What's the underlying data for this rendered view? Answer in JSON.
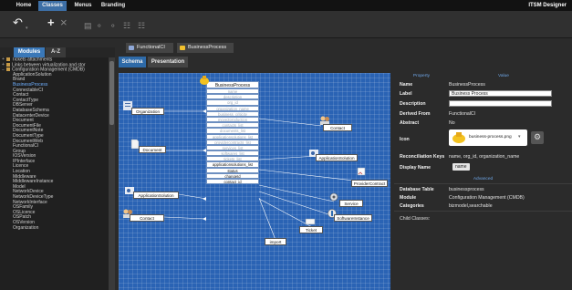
{
  "menu": {
    "tabs": [
      {
        "label": "Home",
        "active": false
      },
      {
        "label": "Classes",
        "active": true
      },
      {
        "label": "Menus",
        "active": false
      },
      {
        "label": "Branding",
        "active": false
      }
    ],
    "app_title": "ITSM Designer"
  },
  "toolbar": {
    "undo_icon": "undo-icon",
    "add_icon": "plus-icon",
    "delete_icon": "close-icon"
  },
  "left_panel": {
    "tabs": [
      {
        "label": "Modules",
        "active": true
      },
      {
        "label": "A-Z",
        "active": false
      }
    ],
    "tree": [
      {
        "label": "Tickets attachments",
        "folder": true,
        "expander": "+",
        "indent": 0
      },
      {
        "label": "Links between virtualization and stor",
        "folder": true,
        "expander": "+",
        "indent": 0
      },
      {
        "label": "Configuration Management (CMDB)",
        "folder": true,
        "expander": "−",
        "indent": 0
      },
      {
        "label": "ApplicationSolution",
        "indent": 1
      },
      {
        "label": "Brand",
        "indent": 1
      },
      {
        "label": "BusinessProcess",
        "indent": 1,
        "selected": true
      },
      {
        "label": "ConnectableCI",
        "indent": 1
      },
      {
        "label": "Contact",
        "indent": 1
      },
      {
        "label": "ContactType",
        "indent": 1
      },
      {
        "label": "DBServer",
        "indent": 1
      },
      {
        "label": "DatabaseSchema",
        "indent": 1
      },
      {
        "label": "DatacenterDevice",
        "indent": 1
      },
      {
        "label": "Document",
        "indent": 1
      },
      {
        "label": "DocumentFile",
        "indent": 1
      },
      {
        "label": "DocumentNote",
        "indent": 1
      },
      {
        "label": "DocumentType",
        "indent": 1
      },
      {
        "label": "DocumentWeb",
        "indent": 1
      },
      {
        "label": "FunctionalCI",
        "indent": 1
      },
      {
        "label": "Group",
        "indent": 1
      },
      {
        "label": "IOSVersion",
        "indent": 1
      },
      {
        "label": "IPInterface",
        "indent": 1
      },
      {
        "label": "Licence",
        "indent": 1
      },
      {
        "label": "Location",
        "indent": 1
      },
      {
        "label": "Middleware",
        "indent": 1
      },
      {
        "label": "MiddlewareInstance",
        "indent": 1
      },
      {
        "label": "Model",
        "indent": 1
      },
      {
        "label": "NetworkDevice",
        "indent": 1
      },
      {
        "label": "NetworkDeviceType",
        "indent": 1
      },
      {
        "label": "NetworkInterface",
        "indent": 1
      },
      {
        "label": "OSFamily",
        "indent": 1
      },
      {
        "label": "OSLicence",
        "indent": 1
      },
      {
        "label": "OSPatch",
        "indent": 1
      },
      {
        "label": "OSVersion",
        "indent": 1
      },
      {
        "label": "Organization",
        "indent": 1
      }
    ]
  },
  "doc_tabs": [
    {
      "label": "FunctionalCI",
      "icon": "class-icon",
      "color": "#8fa8d8"
    },
    {
      "label": "BusinessProcess",
      "icon": "business-process-icon",
      "color": "#f2c12e"
    }
  ],
  "view_tabs": [
    {
      "label": "Schema",
      "active": true
    },
    {
      "label": "Presentation",
      "active": false
    }
  ],
  "schema": {
    "main_class": "BusinessProcess",
    "attributes": [
      {
        "label": "name",
        "strong": false
      },
      {
        "label": "description",
        "strong": false
      },
      {
        "label": "org_id",
        "strong": false
      },
      {
        "label": "organization_name",
        "strong": false
      },
      {
        "label": "business_criticity",
        "strong": false
      },
      {
        "label": "move2production",
        "strong": false
      },
      {
        "label": "contacts_list",
        "strong": false
      },
      {
        "label": "documents_list",
        "strong": false
      },
      {
        "label": "applicationsolutions_list",
        "strong": false
      },
      {
        "label": "providercontracts_list",
        "strong": false
      },
      {
        "label": "services_list",
        "strong": false
      },
      {
        "label": "softwares_list",
        "strong": false
      },
      {
        "label": "tickets_list",
        "strong": false
      },
      {
        "label": "applicationsolutions_list",
        "strong": true
      },
      {
        "label": "status",
        "strong": true
      },
      {
        "label": "changeId",
        "strong": true
      },
      {
        "label": "contact_id",
        "strong": true
      }
    ],
    "related": {
      "organization": "Organization",
      "document": "Document",
      "contact": "Contact",
      "application_solution": "ApplicationSolution",
      "provider_contract": "ProviderContract",
      "service": "Service",
      "software_instance": "SoftwareInstance",
      "ticket": "Ticket",
      "application_solution_left": "ApplicationSolution",
      "contact_left": "Contact",
      "import": "import"
    }
  },
  "properties": {
    "col_headers": [
      "Property",
      "Value"
    ],
    "name": {
      "label": "Name",
      "value": "BusinessProcess"
    },
    "label": {
      "label": "Label",
      "value": "Business Process"
    },
    "description": {
      "label": "Description",
      "value": ""
    },
    "derived_from": {
      "label": "Derived From",
      "value": "FunctionalCI"
    },
    "abstract": {
      "label": "Abstract",
      "value": "No"
    },
    "icon": {
      "label": "Icon",
      "value": "business-process.png"
    },
    "reconciliation_keys": {
      "label": "Reconciliation Keys",
      "value": "name, org_id, organization_name"
    },
    "display_name": {
      "label": "Display Name",
      "value": "name"
    },
    "advanced_header": "Advanced",
    "database_table": {
      "label": "Database Table",
      "value": "businessprocess"
    },
    "module": {
      "label": "Module",
      "value": "Configuration Management (CMDB)"
    },
    "categories": {
      "label": "Categories",
      "value": "bizmodel,searchable"
    },
    "child_classes": "Child Classes:"
  }
}
